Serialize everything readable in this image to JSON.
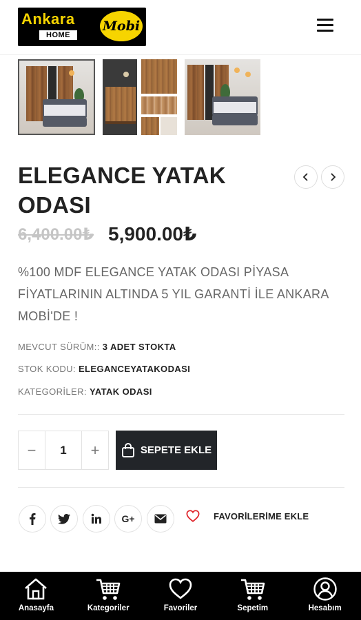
{
  "header": {
    "logo_ankara": "Ankara",
    "logo_home": "HOME",
    "logo_mobi": "Mobi",
    "menu_icon": "hamburger-menu-icon"
  },
  "gallery": {
    "thumb_count": 3,
    "active_index": 0
  },
  "product": {
    "title": "ELEGANCE YATAK ODASI",
    "old_price": "6,400.00₺",
    "price": "5,900.00₺",
    "description": "%100 MDF ELEGANCE YATAK ODASI PİYASA FİYATLARININ ALTINDA 5 YIL GARANTİ İLE ANKARA MOBİ'DE !",
    "meta": {
      "stock_label": "MEVCUT SÜRÜM::",
      "stock_value": "3 ADET STOKTA",
      "sku_label": "STOK KODU:",
      "sku_value": "ELEGANCEYATAKODASI",
      "category_label": "KATEGORİLER:",
      "category_value": "YATAK ODASI"
    }
  },
  "cart": {
    "minus": "−",
    "quantity": "1",
    "plus": "+",
    "add_label": "SEPETE EKLE"
  },
  "share": {
    "icons": [
      "facebook-icon",
      "twitter-icon",
      "linkedin-icon",
      "google-plus-icon",
      "email-icon"
    ],
    "google_plus": "G+",
    "favorite_label": "FAVORİLERİME EKLE"
  },
  "bottom_nav": {
    "items": [
      {
        "label": "Anasayfa",
        "icon": "home-icon"
      },
      {
        "label": "Kategoriler",
        "icon": "cart-icon"
      },
      {
        "label": "Favoriler",
        "icon": "heart-icon"
      },
      {
        "label": "Sepetim",
        "icon": "cart-icon"
      },
      {
        "label": "Hesabım",
        "icon": "user-icon"
      }
    ]
  },
  "colors": {
    "logo_yellow": "#f6d400",
    "button_dark": "#222529",
    "heart_red": "#e0282e",
    "bottom_nav_bg": "#000000"
  }
}
